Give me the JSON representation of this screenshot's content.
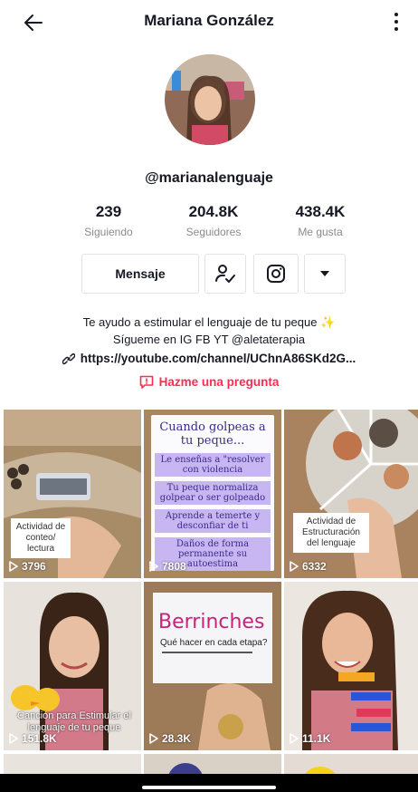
{
  "header": {
    "title": "Mariana González",
    "back_icon": "arrow-left-icon",
    "more_icon": "more-vertical-icon"
  },
  "profile": {
    "username": "@marianalenguaje",
    "stats": [
      {
        "value": "239",
        "label": "Siguiendo"
      },
      {
        "value": "204.8K",
        "label": "Seguidores"
      },
      {
        "value": "438.4K",
        "label": "Me gusta"
      }
    ],
    "message_label": "Mensaje",
    "bio_line1": "Te ayudo a estimular el lenguaje de tu peque ✨",
    "bio_line2": "Sígueme en IG FB YT @aletaterapia",
    "link": "https://youtube.com/channel/UChnA86SKd2G...",
    "ask_label": "Hazme una pregunta"
  },
  "videos": [
    {
      "views": "3796",
      "caption": "Actividad de conteo/ lectura"
    },
    {
      "views": "7808",
      "caption": "Cuando golpeas a tu peque..."
    },
    {
      "views": "6332",
      "caption": "Actividad de Estructuración del lenguaje"
    },
    {
      "views": "151.8K",
      "caption": "Canción para Estimular el lenguaje de tu peque"
    },
    {
      "views": "28.3K",
      "caption": "Berrinches"
    },
    {
      "views": "11.1K",
      "caption": ""
    }
  ],
  "whiteboard": {
    "title": "Cuando golpeas a tu peque...",
    "lines": [
      "Le enseñas a \"resolver con violencia",
      "Tu peque normaliza golpear o ser golpeado",
      "Aprende a temerte y desconfiar de ti",
      "Daños de forma permanente su autoestima"
    ]
  },
  "berrinches": {
    "title": "Berrinches",
    "subtitle": "Qué hacer en cada etapa?"
  },
  "colors": {
    "accent": "#fe2c55",
    "text": "#161823",
    "muted": "#8a8b91",
    "border": "#e3e3e4"
  }
}
